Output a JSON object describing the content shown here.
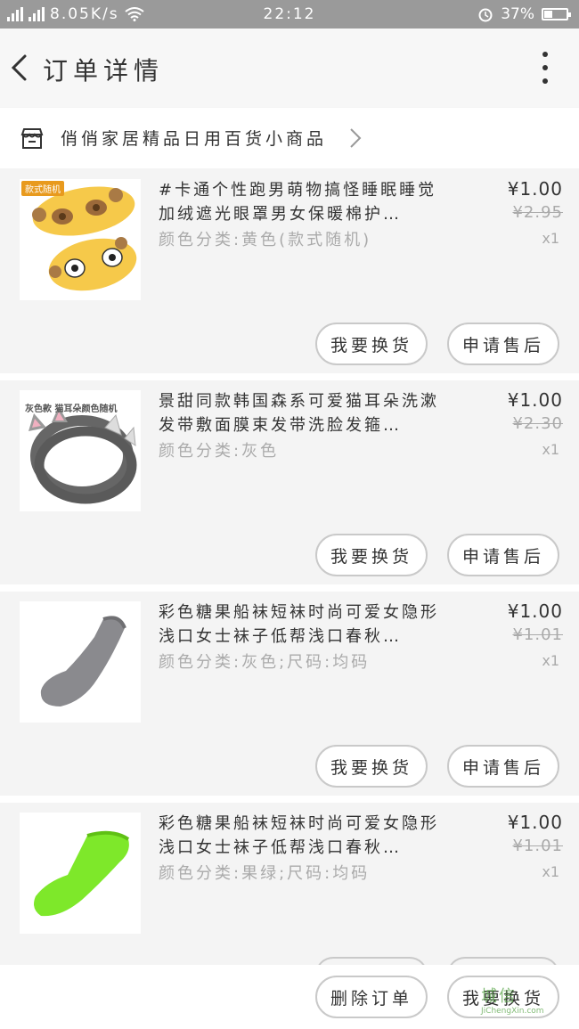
{
  "status_bar": {
    "network_left": "4G",
    "network_right": "2G",
    "speed": "8.05K/s",
    "time": "22:12",
    "battery": "37%",
    "battery_level": 0.37
  },
  "header": {
    "title": "订单详情"
  },
  "shop": {
    "name": "俏俏家居精品日用百货小商品"
  },
  "items": [
    {
      "title": "#卡通个性跑男萌物搞怪睡眠睡觉加绒遮光眼罩男女保暖棉护…",
      "spec": "颜色分类:黄色(款式随机)",
      "price": "¥1.00",
      "original_price": "¥2.95",
      "qty": "x1",
      "badge": "款式随机",
      "btn_left": "我要换货",
      "btn_right": "申请售后"
    },
    {
      "title": "景甜同款韩国森系可爱猫耳朵洗漱发带敷面膜束发带洗脸发箍…",
      "spec": "颜色分类:灰色",
      "price": "¥1.00",
      "original_price": "¥2.30",
      "qty": "x1",
      "caption": "灰色款 猫耳朵颜色随机",
      "btn_left": "我要换货",
      "btn_right": "申请售后"
    },
    {
      "title": "彩色糖果船袜短袜时尚可爱女隐形浅口女士袜子低帮浅口春秋…",
      "spec": "颜色分类:灰色;尺码:均码",
      "price": "¥1.00",
      "original_price": "¥1.01",
      "qty": "x1",
      "btn_left": "我要换货",
      "btn_right": "申请售后"
    },
    {
      "title": "彩色糖果船袜短袜时尚可爱女隐形浅口女士袜子低帮浅口春秋…",
      "spec": "颜色分类:果绿;尺码:均码",
      "price": "¥1.00",
      "original_price": "¥1.01",
      "qty": "x1"
    }
  ],
  "bottom_bar": {
    "delete_label": "删除订单",
    "exchange_label": "我要换货"
  },
  "watermark": {
    "text": "城信",
    "sub": "JiChengXin.com"
  },
  "colors": {
    "status_bar": "#9a9a9a",
    "badge": "#e89a1e",
    "sock_gray": "#8a8a8e",
    "sock_green": "#7ee82a",
    "mask_yellow": "#f6c94a"
  }
}
